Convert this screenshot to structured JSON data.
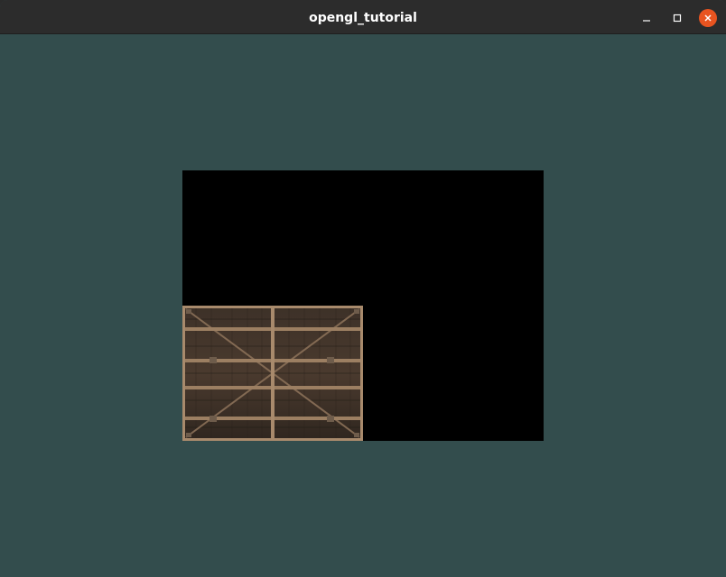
{
  "window": {
    "title": "opengl_tutorial",
    "controls": {
      "minimize_icon": "minimize-icon",
      "maximize_icon": "maximize-icon",
      "close_icon": "close-icon"
    }
  },
  "colors": {
    "clear_color": "#334d4d",
    "viewport_bg": "#000000",
    "titlebar": "#2c2c2c",
    "close_button": "#e95420"
  },
  "scene": {
    "texture": "wooden-crate"
  }
}
